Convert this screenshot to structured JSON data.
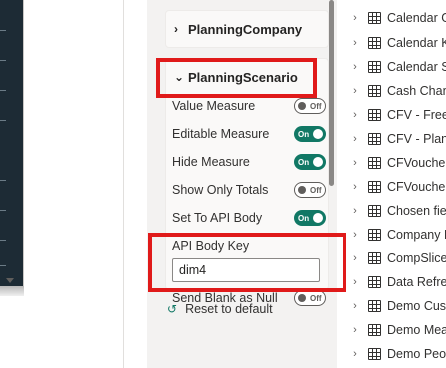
{
  "format_pane": {
    "sections": [
      {
        "label": "PlanningCompany",
        "expanded": false
      },
      {
        "label": "PlanningScenario",
        "expanded": true
      }
    ],
    "properties": [
      {
        "label": "Value Measure",
        "state": "Off"
      },
      {
        "label": "Editable Measure",
        "state": "On"
      },
      {
        "label": "Hide Measure",
        "state": "On"
      },
      {
        "label": "Show Only Totals",
        "state": "Off"
      },
      {
        "label": "Set To API Body",
        "state": "On"
      },
      {
        "label": "Send Blank as Null",
        "state": "Off"
      }
    ],
    "api_body_key": {
      "label": "API Body Key",
      "value": "dim4"
    },
    "reset_label": "Reset to default"
  },
  "fields": [
    "Calendar Ge",
    "Calendar KP",
    "Calendar Sa",
    "Cash Chang",
    "CFV - Free c",
    "CFV - Plann",
    "CFVoucher c",
    "CFVoucherC",
    "Chosen field",
    "Company D",
    "CompSlicer",
    "Data Refresl",
    "Demo Custo",
    "Demo Meas",
    "Demo Peop"
  ],
  "colors": {
    "toggle_on": "#117865",
    "highlight": "#e01a1a",
    "visual_bg": "#1d2b35"
  }
}
